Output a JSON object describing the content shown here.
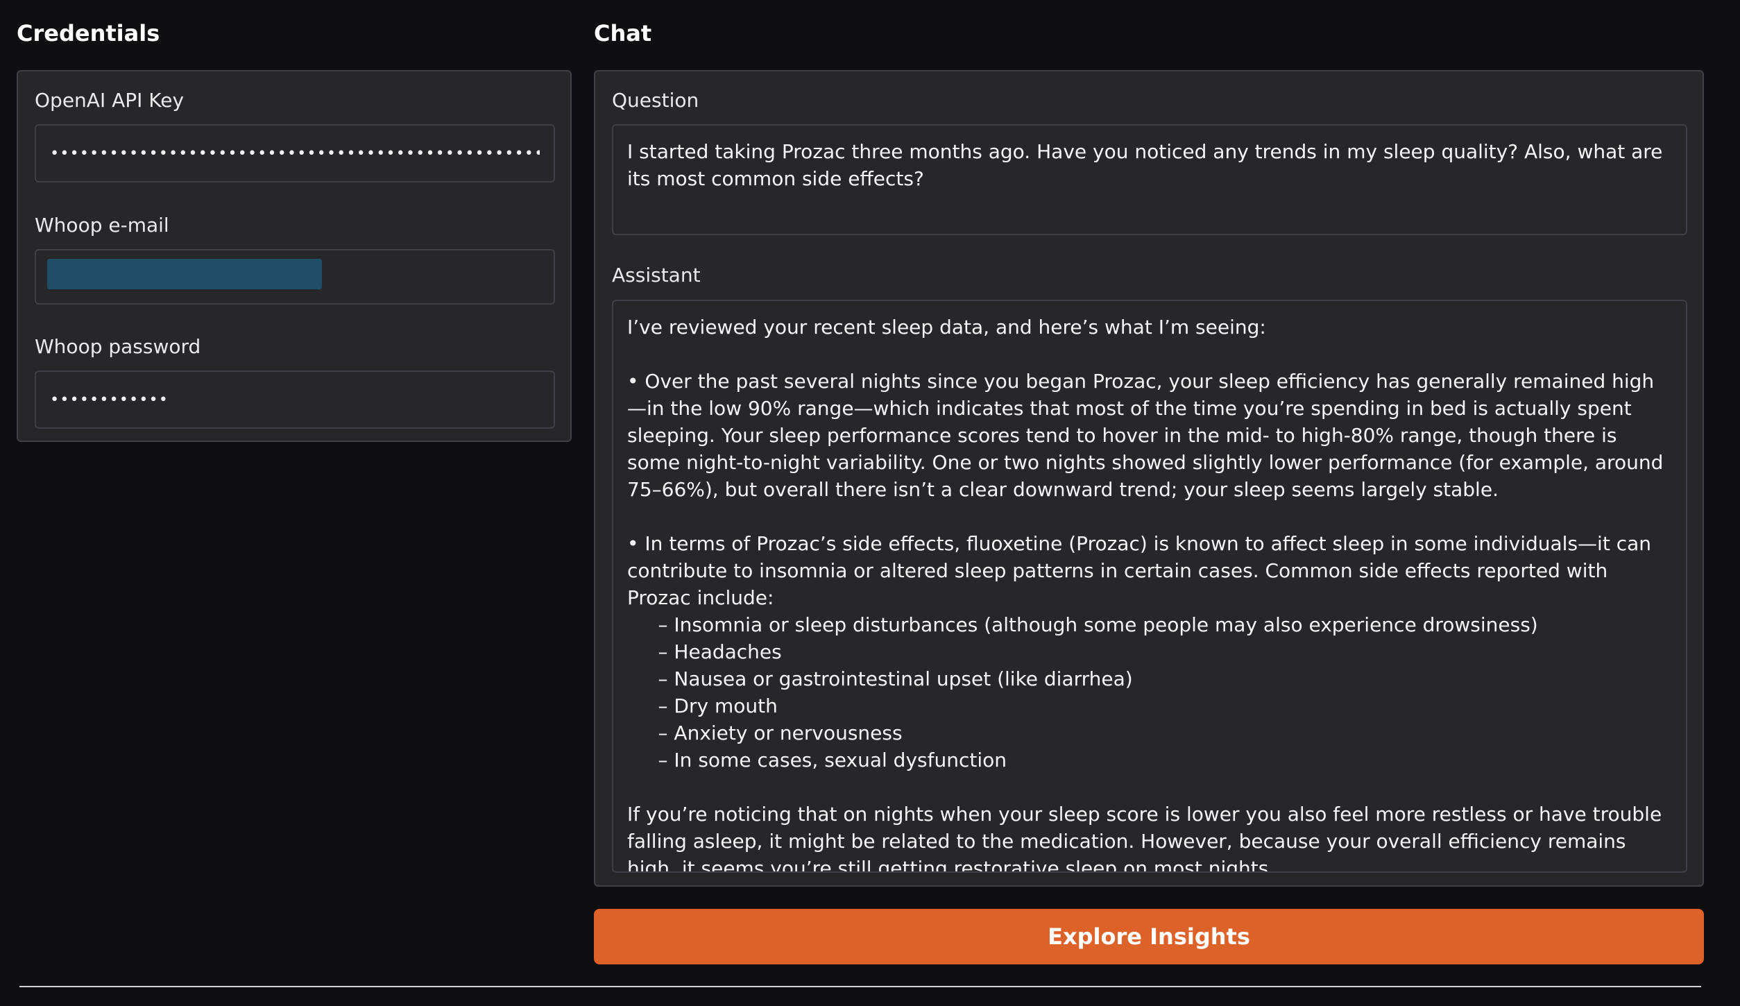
{
  "credentials": {
    "title": "Credentials",
    "openai_key": {
      "label": "OpenAI API Key",
      "value": "••••••••••••••••••••••••••••••••••••••••••••••••••••••"
    },
    "whoop_email": {
      "label": "Whoop e-mail",
      "value": ""
    },
    "whoop_password": {
      "label": "Whoop password",
      "value": "••••••••••••"
    }
  },
  "chat": {
    "title": "Chat",
    "question": {
      "label": "Question",
      "value": "I started taking Prozac three months ago. Have you noticed any trends in my sleep quality? Also, what are its most common side effects?"
    },
    "assistant": {
      "label": "Assistant",
      "value": "I’ve reviewed your recent sleep data, and here’s what I’m seeing:\n\n• Over the past several nights since you began Prozac, your sleep efficiency has generally remained high—in the low 90% range—which indicates that most of the time you’re spending in bed is actually spent sleeping. Your sleep performance scores tend to hover in the mid- to high-80% range, though there is some night-to-night variability. One or two nights showed slightly lower performance (for example, around 75–66%), but overall there isn’t a clear downward trend; your sleep seems largely stable.\n\n• In terms of Prozac’s side effects, fluoxetine (Prozac) is known to affect sleep in some individuals—it can contribute to insomnia or altered sleep patterns in certain cases. Common side effects reported with Prozac include:\n     – Insomnia or sleep disturbances (although some people may also experience drowsiness)\n     – Headaches\n     – Nausea or gastrointestinal upset (like diarrhea)\n     – Dry mouth\n     – Anxiety or nervousness\n     – In some cases, sexual dysfunction\n\nIf you’re noticing that on nights when your sleep score is lower you also feel more restless or have trouble falling asleep, it might be related to the medication. However, because your overall efficiency remains high, it seems you’re still getting restorative sleep on most nights."
    },
    "button_label": "Explore Insights"
  },
  "colors": {
    "background": "#0f0f11",
    "panel": "#27272a",
    "border": "#3f3f46",
    "accent": "#dd6229",
    "email_autofill": "#1f4d66"
  }
}
